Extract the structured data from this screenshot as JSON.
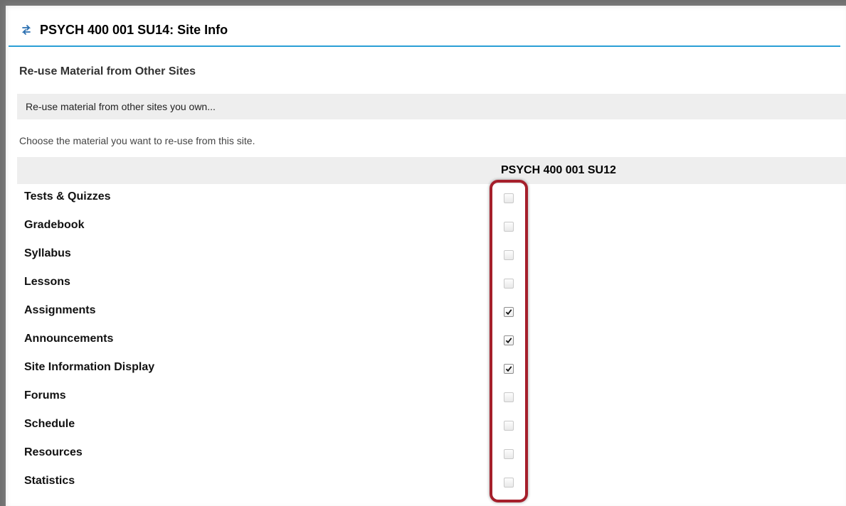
{
  "header": {
    "icon": "refresh-arrows-icon",
    "title": "PSYCH 400 001 SU14: Site Info"
  },
  "section": {
    "heading": "Re-use Material from Other Sites",
    "instruction": "Re-use material from other sites you own...",
    "prompt": "Choose the material you want to re-use from this site."
  },
  "table": {
    "column_header": "PSYCH 400 001 SU12",
    "rows": [
      {
        "label": "Tests & Quizzes",
        "checked": false
      },
      {
        "label": "Gradebook",
        "checked": false
      },
      {
        "label": "Syllabus",
        "checked": false
      },
      {
        "label": "Lessons",
        "checked": false
      },
      {
        "label": "Assignments",
        "checked": true
      },
      {
        "label": "Announcements",
        "checked": true
      },
      {
        "label": "Site Information Display",
        "checked": true
      },
      {
        "label": "Forums",
        "checked": false
      },
      {
        "label": "Schedule",
        "checked": false
      },
      {
        "label": "Resources",
        "checked": false
      },
      {
        "label": "Statistics",
        "checked": false
      }
    ]
  },
  "colors": {
    "title_underline": "#2a9fd6",
    "highlight_box": "#a51f2b"
  }
}
